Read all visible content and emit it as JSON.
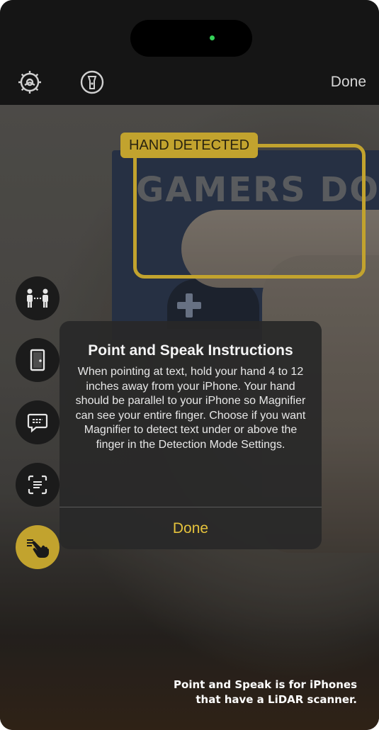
{
  "topbar": {
    "settings_icon": "gear-icon",
    "flashlight_icon": "flashlight-icon",
    "done_label": "Done"
  },
  "camera": {
    "poster_text": "GAMERS DON'T"
  },
  "detection": {
    "label": "HAND DETECTED",
    "color": "#c2a32e"
  },
  "side_buttons": [
    {
      "icon": "people-detection-icon"
    },
    {
      "icon": "door-detection-icon"
    },
    {
      "icon": "image-description-icon"
    },
    {
      "icon": "text-detection-icon"
    },
    {
      "icon": "point-and-speak-icon",
      "active": true
    }
  ],
  "dialog": {
    "title": "Point and Speak Instructions",
    "body": "When pointing at text, hold your hand 4 to 12 inches away from your iPhone. Your hand should be parallel to your iPhone so Magnifier can see your entire finger. Choose if you want Magnifier to detect text under or above the finger in the Detection Mode Settings.",
    "done_label": "Done",
    "accent": "#e5c23c"
  },
  "caption": {
    "line1": "Point and Speak is for iPhones",
    "line2": "that have a LiDAR scanner."
  }
}
